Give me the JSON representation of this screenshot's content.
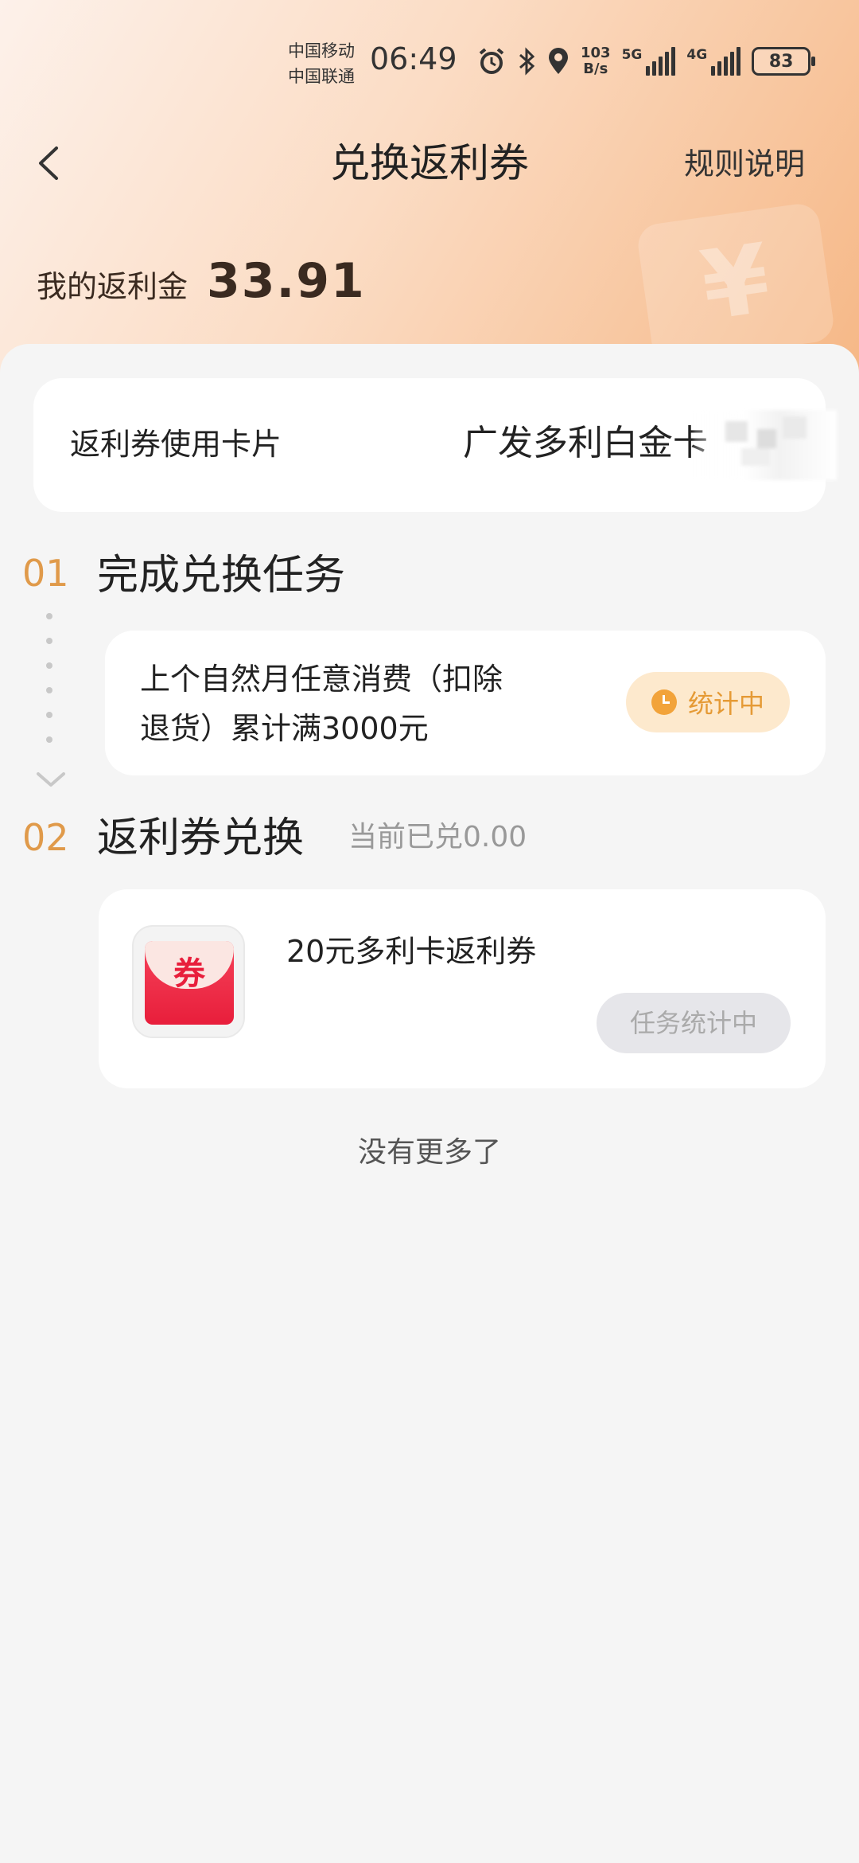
{
  "status_bar": {
    "carrier_1": "中国移动",
    "carrier_2": "中国联通",
    "time": "06:49",
    "net_speed_value": "103",
    "net_speed_unit": "B/s",
    "signal_1": "5G",
    "signal_2": "4G",
    "battery": "83",
    "icons": [
      "alarm-icon",
      "bluetooth-icon",
      "location-icon"
    ]
  },
  "header": {
    "title": "兑换返利券",
    "rules_label": "规则说明",
    "balance_label": "我的返利金",
    "balance_value": "33.91"
  },
  "usage_card": {
    "label": "返利券使用卡片",
    "value": "广发多利白金卡"
  },
  "step1": {
    "number": "01",
    "title": "完成兑换任务",
    "task_text_line1": "上个自然月任意消费（扣除",
    "task_text_line2": "退货）累计满3000元",
    "status": "统计中"
  },
  "step2": {
    "number": "02",
    "title": "返利券兑换",
    "subtitle": "当前已兑0.00",
    "coupon_char": "券",
    "coupon_title": "20元多利卡返利券",
    "coupon_button": "任务统计中"
  },
  "footer": {
    "no_more": "没有更多了"
  },
  "colors": {
    "accent_orange": "#e09a4a",
    "pill_bg": "#fde9cd",
    "coupon_red": "#e81e3b"
  }
}
